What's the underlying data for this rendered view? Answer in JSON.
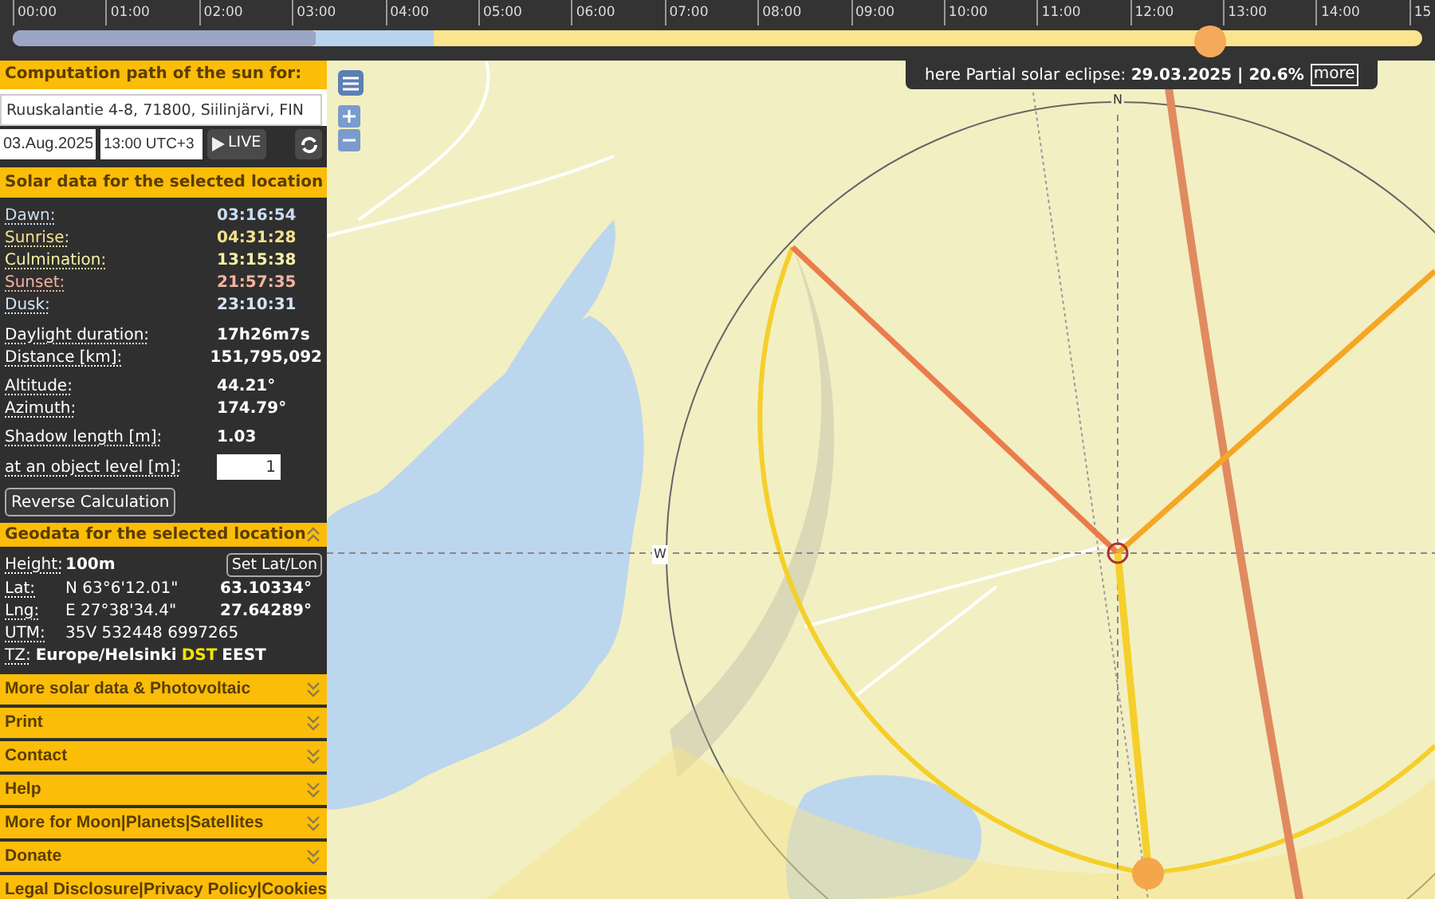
{
  "timeline": {
    "hours": [
      "00:00",
      "01:00",
      "02:00",
      "03:00",
      "04:00",
      "05:00",
      "06:00",
      "07:00",
      "08:00",
      "09:00",
      "10:00",
      "11:00",
      "12:00",
      "13:00",
      "14:00",
      "15"
    ],
    "level": 0.85
  },
  "sidebar": {
    "header": "Computation path of the sun for:",
    "address": "Ruuskalantie 4-8, 71800, Siilinjärvi, FIN",
    "date": "03.Aug.2025",
    "time": "13:00 UTC+3",
    "live_button": "LIVE",
    "solar_header": "Solar data for the selected location",
    "times": [
      {
        "label": "Dawn:",
        "value": "03:16:54",
        "color": "#c9dcf2"
      },
      {
        "label": "Sunrise:",
        "value": "04:31:28",
        "color": "#f3e28a"
      },
      {
        "label": "Culmination:",
        "value": "13:15:38",
        "color": "#f5f2a6"
      },
      {
        "label": "Sunset:",
        "value": "21:57:35",
        "color": "#f3b3a0"
      },
      {
        "label": "Dusk:",
        "value": "23:10:31",
        "color": "#d4e4f6"
      }
    ],
    "stats": [
      {
        "label": "Daylight duration:",
        "value": "17h26m7s"
      },
      {
        "label": "Distance [km]:",
        "value": "151,795,092"
      }
    ],
    "position": [
      {
        "label": "Altitude:",
        "value": "44.21°"
      },
      {
        "label": "Azimuth:",
        "value": "174.79°"
      }
    ],
    "shadow": {
      "label": "Shadow length [m]:",
      "value": "1.03"
    },
    "object_level": {
      "label": "at an object level [m]:",
      "value": "1"
    },
    "reverse_button": "Reverse Calculation",
    "geodata": {
      "header": "Geodata for the selected location",
      "expanded": true,
      "height_label": "Height:",
      "height": "100m",
      "set_button": "Set Lat/Lon",
      "lat_label": "Lat:",
      "lat_dms": "N 63°6'12.01\"",
      "lat_dec": "63.10334°",
      "lng_label": "Lng:",
      "lng_dms": "E 27°38'34.4\"",
      "lng_dec": "27.64289°",
      "utm_label": "UTM:",
      "utm": "35V 532448 6997265",
      "tz_label": "TZ:",
      "tz": "Europe/Helsinki",
      "dst": "DST",
      "tz_abbr": "EEST"
    },
    "sections": [
      {
        "label": "More solar data & Photovoltaic",
        "expanded": false
      },
      {
        "label": "Print",
        "expanded": false
      },
      {
        "label": "Contact",
        "expanded": false
      },
      {
        "label": "Help",
        "expanded": false
      },
      {
        "label": "More for Moon|Planets|Satellites",
        "expanded": false
      },
      {
        "label": "Donate",
        "expanded": false
      },
      {
        "label": "Legal Disclosure|Privacy Policy|Cookies",
        "expanded": false
      }
    ]
  },
  "map": {
    "banner": {
      "text": "here Partial solar eclipse: ",
      "highlight": "29.03.2025 | 20.6%",
      "link": "more"
    },
    "north": "N",
    "west": "W"
  }
}
